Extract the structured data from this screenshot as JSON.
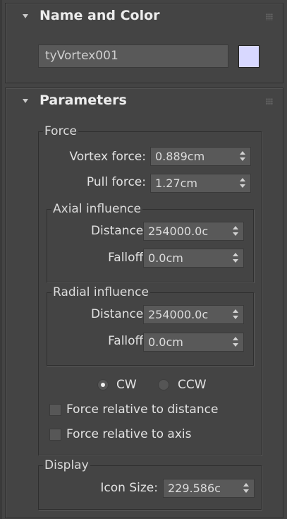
{
  "name_color": {
    "title": "Name and Color",
    "object_name": "tyVortex001",
    "swatch_color": "#d8d8ff"
  },
  "parameters": {
    "title": "Parameters",
    "force_group": {
      "label": "Force",
      "vortex_force_label": "Vortex force:",
      "vortex_force_value": "0.889cm",
      "pull_force_label": "Pull force:",
      "pull_force_value": "1.27cm",
      "axial": {
        "label": "Axial influence",
        "distance_label": "Distance:",
        "distance_value": "254000.0c",
        "falloff_label": "Falloff:",
        "falloff_value": "0.0cm"
      },
      "radial": {
        "label": "Radial influence",
        "distance_label": "Distance:",
        "distance_value": "254000.0c",
        "falloff_label": "Falloff:",
        "falloff_value": "0.0cm"
      },
      "direction": {
        "cw_label": "CW",
        "ccw_label": "CCW",
        "selected": "CW"
      },
      "force_relative_distance_label": "Force relative to distance",
      "force_relative_distance_checked": false,
      "force_relative_axis_label": "Force relative to axis",
      "force_relative_axis_checked": false
    },
    "display_group": {
      "label": "Display",
      "icon_size_label": "Icon Size:",
      "icon_size_value": "229.586c"
    }
  }
}
